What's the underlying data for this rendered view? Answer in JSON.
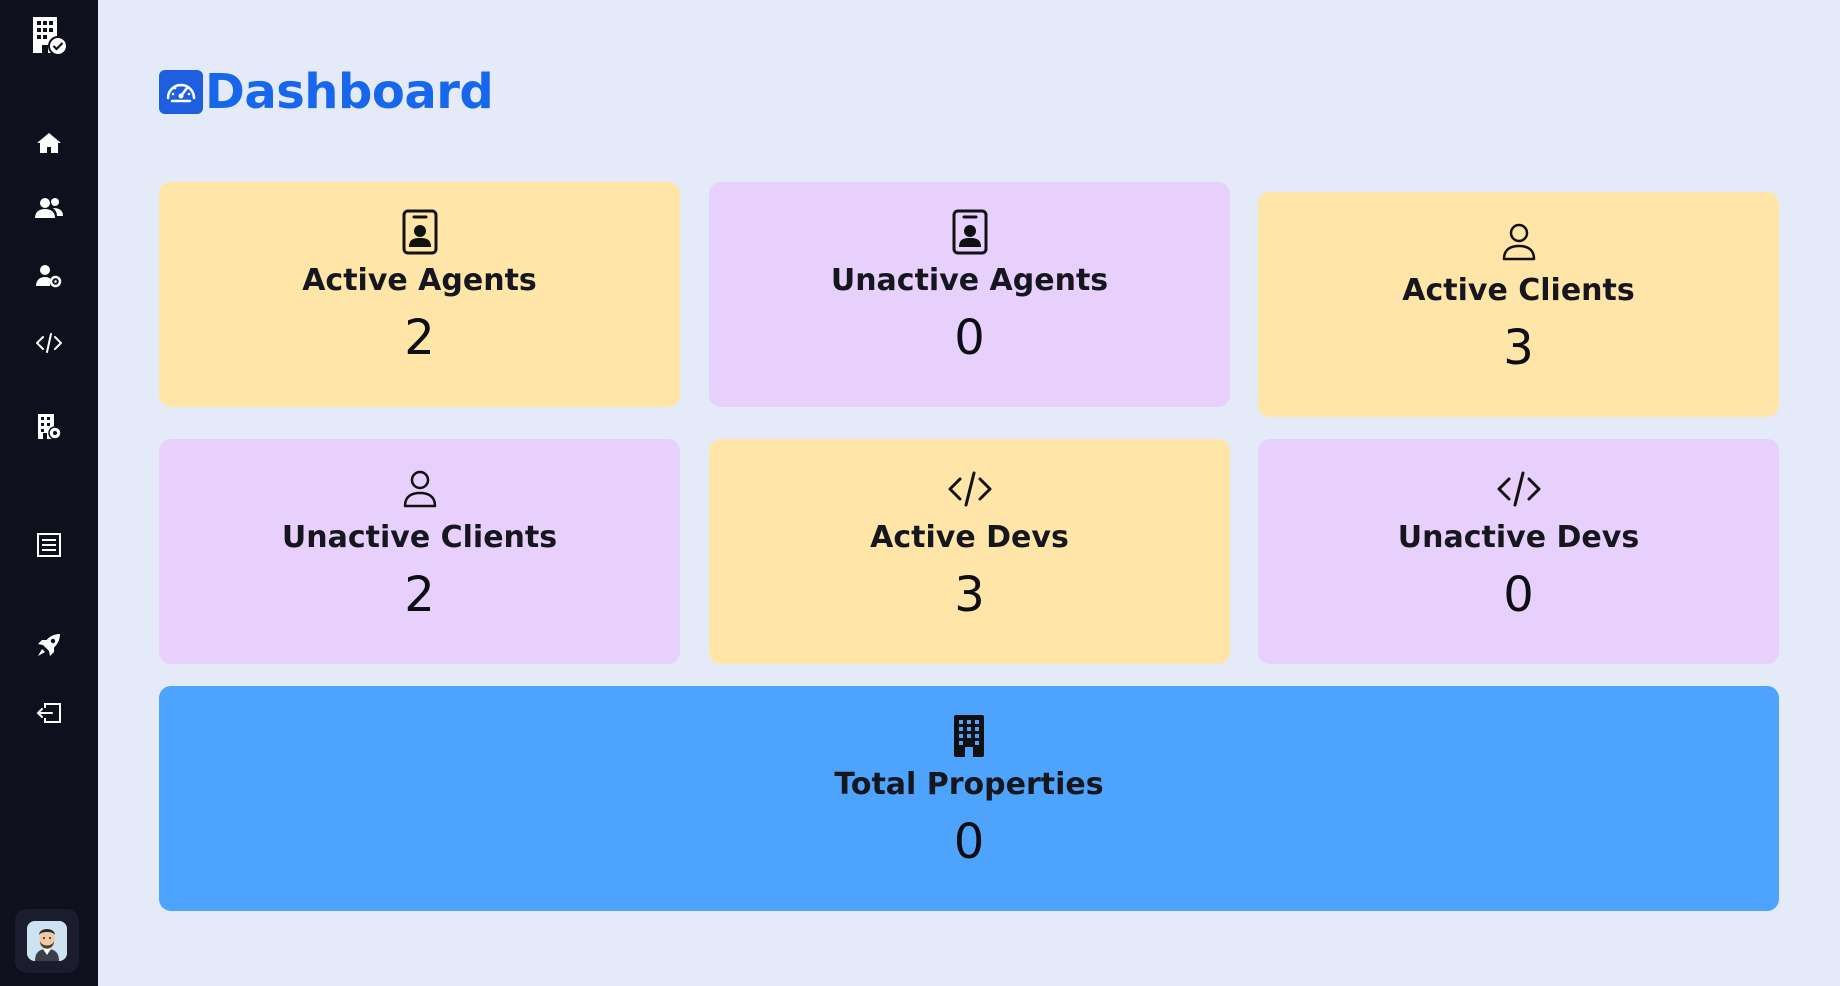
{
  "sidebar": {
    "items": [
      {
        "icon": "building-check-icon"
      },
      {
        "icon": "home-icon"
      },
      {
        "icon": "users-icon"
      },
      {
        "icon": "user-gear-icon"
      },
      {
        "icon": "code-icon"
      },
      {
        "icon": "building-gear-icon"
      },
      {
        "icon": "list-icon"
      },
      {
        "icon": "rocket-icon"
      },
      {
        "icon": "logout-icon"
      }
    ],
    "avatar_icon": "avatar"
  },
  "header": {
    "title": "Dashboard",
    "icon": "speedometer-icon"
  },
  "cards": [
    {
      "label": "Active Agents",
      "value": "2",
      "color": "#ffe6a8",
      "icon": "person-badge-icon"
    },
    {
      "label": "Unactive Agents",
      "value": "0",
      "color": "#e7d0fb",
      "icon": "person-badge-icon"
    },
    {
      "label": "Active Clients",
      "value": "3",
      "color": "#ffe6a8",
      "icon": "person-icon"
    },
    {
      "label": "Unactive Clients",
      "value": "2",
      "color": "#e7d0fb",
      "icon": "person-icon"
    },
    {
      "label": "Active Devs",
      "value": "3",
      "color": "#ffe6a8",
      "icon": "code-icon"
    },
    {
      "label": "Unactive Devs",
      "value": "0",
      "color": "#e7d0fb",
      "icon": "code-icon"
    },
    {
      "label": "Total Properties",
      "value": "0",
      "color": "#4ea3fd",
      "icon": "building-icon"
    }
  ],
  "colors": {
    "accent": "#1767ec",
    "sidebar_bg": "#0f101e",
    "page_bg": "#e4eaf7"
  }
}
